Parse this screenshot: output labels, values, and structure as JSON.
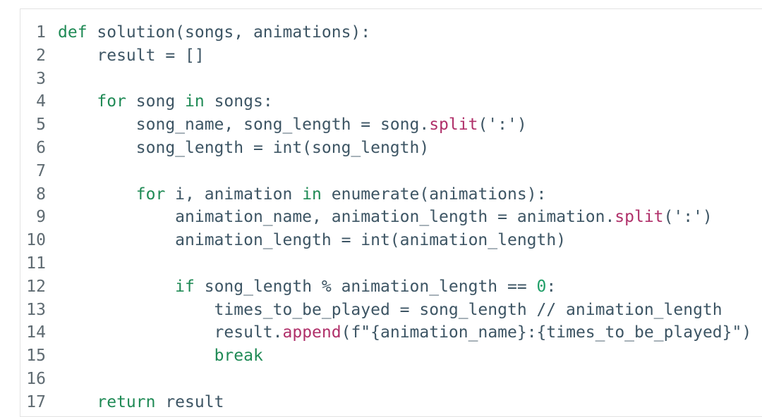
{
  "editor": {
    "lines": [
      {
        "n": "1",
        "tokens": [
          {
            "t": "def",
            "c": "kw"
          },
          {
            "t": " solution(songs, animations):",
            "c": ""
          }
        ]
      },
      {
        "n": "2",
        "tokens": [
          {
            "t": "    result = []",
            "c": ""
          }
        ]
      },
      {
        "n": "3",
        "tokens": []
      },
      {
        "n": "4",
        "tokens": [
          {
            "t": "    ",
            "c": ""
          },
          {
            "t": "for",
            "c": "kw"
          },
          {
            "t": " song ",
            "c": ""
          },
          {
            "t": "in",
            "c": "kw"
          },
          {
            "t": " songs:",
            "c": ""
          }
        ]
      },
      {
        "n": "5",
        "tokens": [
          {
            "t": "        song_name, song_length = song.",
            "c": ""
          },
          {
            "t": "split",
            "c": "fn"
          },
          {
            "t": "(':')",
            "c": ""
          }
        ]
      },
      {
        "n": "6",
        "tokens": [
          {
            "t": "        song_length = int(song_length)",
            "c": ""
          }
        ]
      },
      {
        "n": "7",
        "tokens": []
      },
      {
        "n": "8",
        "tokens": [
          {
            "t": "        ",
            "c": ""
          },
          {
            "t": "for",
            "c": "kw"
          },
          {
            "t": " i, animation ",
            "c": ""
          },
          {
            "t": "in",
            "c": "kw"
          },
          {
            "t": " enumerate(animations):",
            "c": ""
          }
        ]
      },
      {
        "n": "9",
        "tokens": [
          {
            "t": "            animation_name, animation_length = animation.",
            "c": ""
          },
          {
            "t": "split",
            "c": "fn"
          },
          {
            "t": "(':')",
            "c": ""
          }
        ]
      },
      {
        "n": "10",
        "tokens": [
          {
            "t": "            animation_length = int(animation_length)",
            "c": ""
          }
        ]
      },
      {
        "n": "11",
        "tokens": []
      },
      {
        "n": "12",
        "tokens": [
          {
            "t": "            ",
            "c": ""
          },
          {
            "t": "if",
            "c": "kw"
          },
          {
            "t": " song_length % animation_length == ",
            "c": ""
          },
          {
            "t": "0",
            "c": "num"
          },
          {
            "t": ":",
            "c": ""
          }
        ]
      },
      {
        "n": "13",
        "tokens": [
          {
            "t": "                times_to_be_played = song_length // animation_length",
            "c": ""
          }
        ]
      },
      {
        "n": "14",
        "tokens": [
          {
            "t": "                result.",
            "c": ""
          },
          {
            "t": "append",
            "c": "fn"
          },
          {
            "t": "(",
            "c": ""
          },
          {
            "t": "f\"{animation_name}:{times_to_be_played}\"",
            "c": "str"
          },
          {
            "t": ")",
            "c": ""
          }
        ]
      },
      {
        "n": "15",
        "tokens": [
          {
            "t": "                ",
            "c": ""
          },
          {
            "t": "break",
            "c": "kw"
          }
        ]
      },
      {
        "n": "16",
        "tokens": []
      },
      {
        "n": "17",
        "tokens": [
          {
            "t": "    ",
            "c": ""
          },
          {
            "t": "return",
            "c": "kw"
          },
          {
            "t": " result",
            "c": ""
          }
        ]
      }
    ]
  }
}
